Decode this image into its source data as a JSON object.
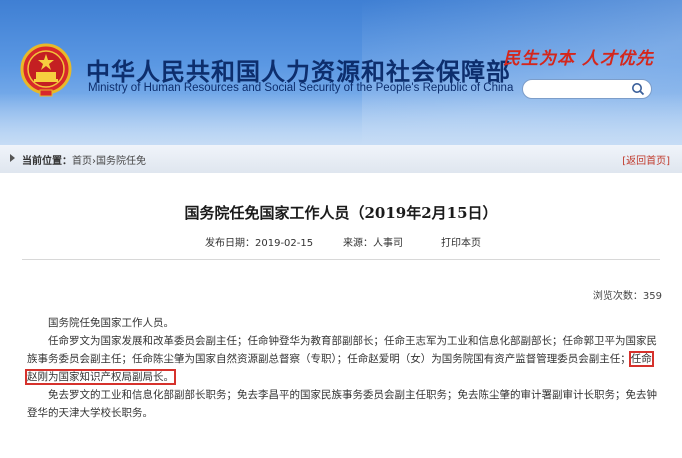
{
  "header": {
    "title_cn": "中华人民共和国人力资源和社会保障部",
    "title_en": "Ministry of Human Resources and Social Security of the People's Republic of China",
    "slogan": "民生为本 人才优先",
    "search": {
      "placeholder": "",
      "value": ""
    }
  },
  "breadcrumb": {
    "label": "当前位置：",
    "path": "首页›国务院任免",
    "back_link": "[返回首页]"
  },
  "article": {
    "title": "国务院任免国家工作人员（2019年2月15日）",
    "publish_date_label": "发布日期：",
    "publish_date": "2019-02-15",
    "source_label": "来源：",
    "source": "人事司",
    "print_label": "打印本页",
    "views_label": "浏览次数：",
    "views": "359",
    "lead": "国务院任免国家工作人员。",
    "para1_part1": "任命罗文为国家发展和改革委员会副主任；任命钟登华为教育部副部长；任命王志军为工业和信息化部副部长；任命郭卫平为国家民族事务委员会副主任；任命陈尘肇为国家自然资源副总督察（专职）；任命赵爱明（女）为国务院国有资产监督管理委员会副主任；",
    "para1_highlight": "任命赵刚为国家知识产权局副局长。",
    "para2": "免去罗文的工业和信息化部副部长职务；免去李昌平的国家民族事务委员会副主任职务；免去陈尘肇的审计署副审计长职务；免去钟登华的天津大学校长职务。"
  },
  "colors": {
    "header_blue": "#3f7fd3",
    "title_navy": "#0d2e6d",
    "slogan_red": "#d4261c",
    "highlight_red": "#d6322c"
  },
  "icons": [
    "national-emblem-icon",
    "search-icon",
    "breadcrumb-arrow-icon"
  ]
}
